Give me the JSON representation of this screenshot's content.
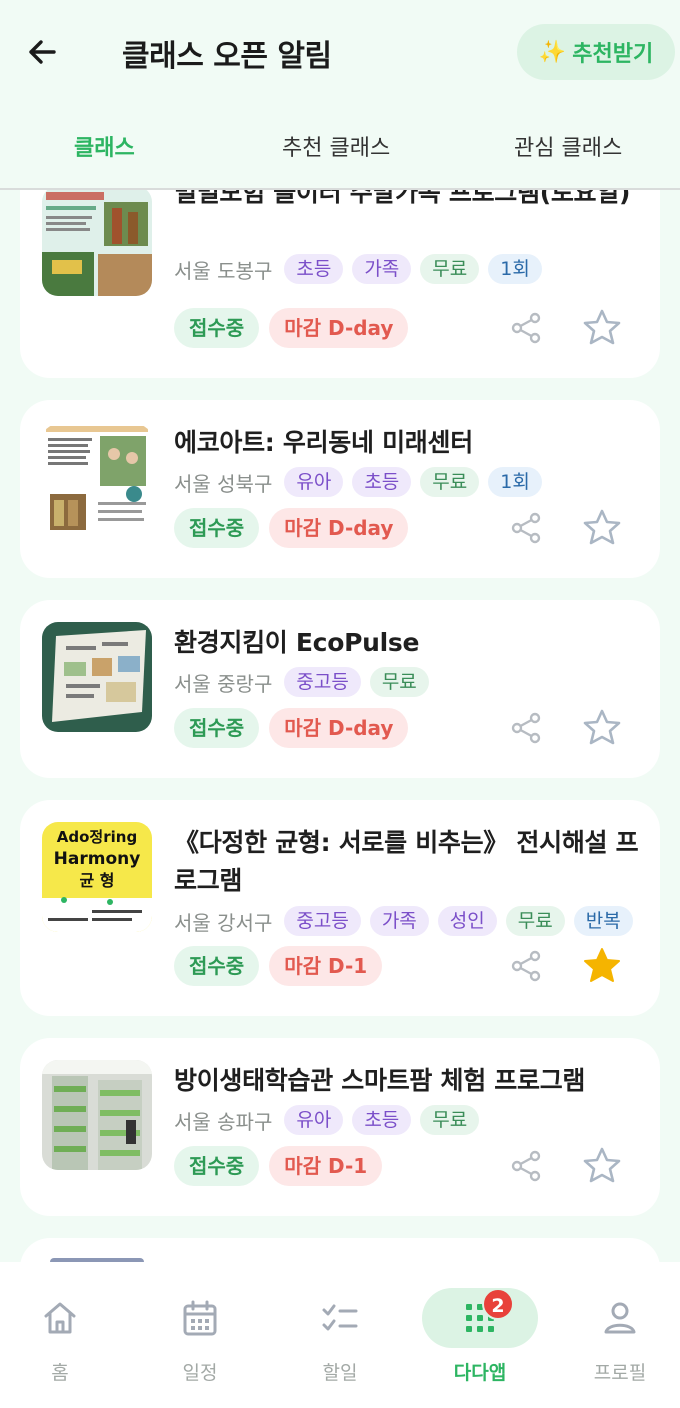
{
  "header": {
    "title": "클래스 오픈 알림",
    "recommend_label": "추천받기",
    "recommend_icon": "sparkles-icon"
  },
  "tabs": [
    {
      "label": "클래스",
      "active": true
    },
    {
      "label": "추천 클래스",
      "active": false
    },
    {
      "label": "관심 클래스",
      "active": false
    }
  ],
  "classes": [
    {
      "title": "별별모험 놀이터 주말가족 프로그램(토요일)",
      "location": "서울 도봉구",
      "tags": [
        "초등",
        "가족",
        "무료",
        "1회"
      ],
      "status": "접수중",
      "deadline": "마감 D-day",
      "starred": false
    },
    {
      "title": "에코아트: 우리동네 미래센터",
      "location": "서울 성북구",
      "tags": [
        "유아",
        "초등",
        "무료",
        "1회"
      ],
      "status": "접수중",
      "deadline": "마감 D-day",
      "starred": false
    },
    {
      "title": "환경지킴이 EcoPulse",
      "location": "서울 중랑구",
      "tags": [
        "중고등",
        "무료"
      ],
      "status": "접수중",
      "deadline": "마감 D-day",
      "starred": false
    },
    {
      "title": "《다정한 균형: 서로를 비추는》 전시해설 프로그램",
      "location": "서울 강서구",
      "tags": [
        "중고등",
        "가족",
        "성인",
        "무료",
        "반복"
      ],
      "status": "접수중",
      "deadline": "마감 D-1",
      "starred": true,
      "thumb_text": [
        "Ado정ring",
        "Harmony",
        "균 형"
      ]
    },
    {
      "title": "방이생태학습관 스마트팜 체험 프로그램",
      "location": "서울 송파구",
      "tags": [
        "유아",
        "초등",
        "무료"
      ],
      "status": "접수중",
      "deadline": "마감 D-1",
      "starred": false
    }
  ],
  "bottom_nav": [
    {
      "label": "홈",
      "icon": "home-icon",
      "active": false
    },
    {
      "label": "일정",
      "icon": "calendar-icon",
      "active": false
    },
    {
      "label": "할일",
      "icon": "checklist-icon",
      "active": false
    },
    {
      "label": "다다앱",
      "icon": "grid-icon",
      "active": true,
      "badge": "2"
    },
    {
      "label": "프로필",
      "icon": "profile-icon",
      "active": false
    }
  ],
  "colors": {
    "accent": "#2db562",
    "background": "#f1fbf5",
    "star_active": "#f5b400",
    "deadline": "#e2594f"
  }
}
